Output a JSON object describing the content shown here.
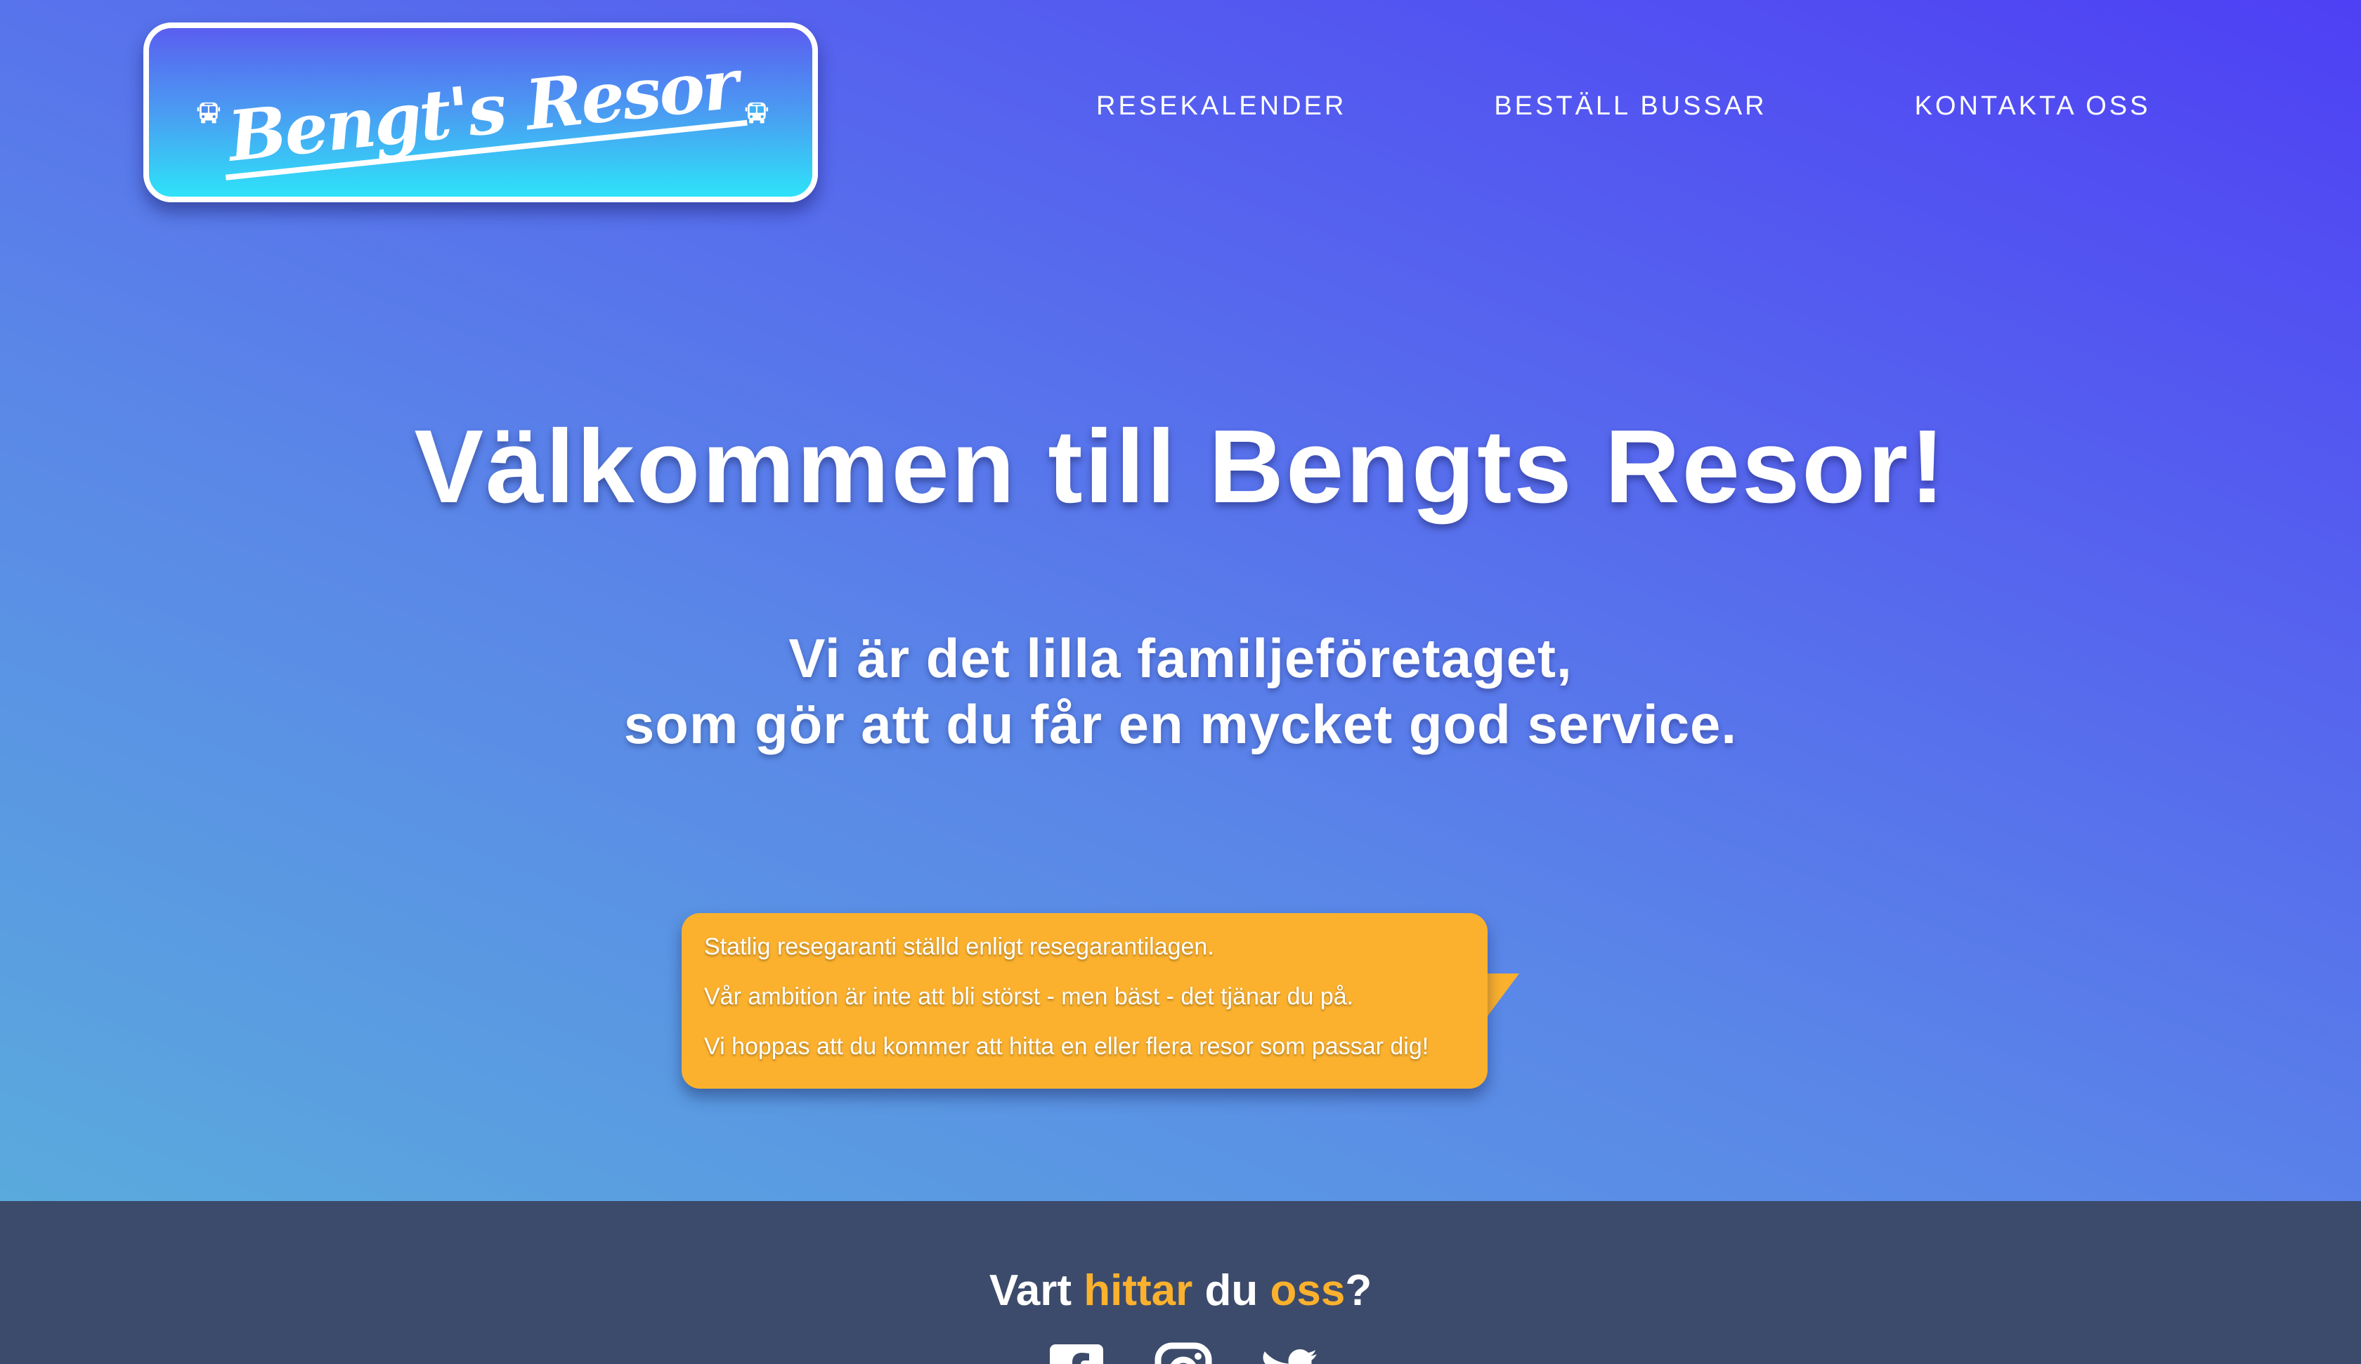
{
  "brand": {
    "logo_text": "Bengt's Resor",
    "gradient_top": "#5a5ef0",
    "gradient_bottom": "#2ee3f8"
  },
  "nav": {
    "items": [
      {
        "label": "RESEKALENDER"
      },
      {
        "label": "BESTÄLL BUSSAR"
      },
      {
        "label": "KONTAKTA OSS"
      }
    ]
  },
  "hero": {
    "title": "Välkommen till Bengts Resor!",
    "tagline_line1": "Vi är det lilla familjeföretaget,",
    "tagline_line2": "som gör att du får en mycket god service."
  },
  "info_bubble": {
    "lines": [
      "Statlig resegaranti ställd enligt resegarantilagen.",
      "Vår ambition är inte att bli störst - men bäst - det tjänar du på.",
      "Vi hoppas att du kommer att hitta en eller flera resor som passar dig!"
    ],
    "color": "#fbb12e"
  },
  "footer": {
    "heading_part1": "Vart",
    "heading_accent1": "hittar",
    "heading_part2": "du",
    "heading_accent2": "oss",
    "heading_end": "?",
    "accent_color": "#fbb12e",
    "background": "#3c4b6b",
    "social_icons": [
      "facebook-icon",
      "instagram-icon",
      "twitter-icon"
    ]
  }
}
